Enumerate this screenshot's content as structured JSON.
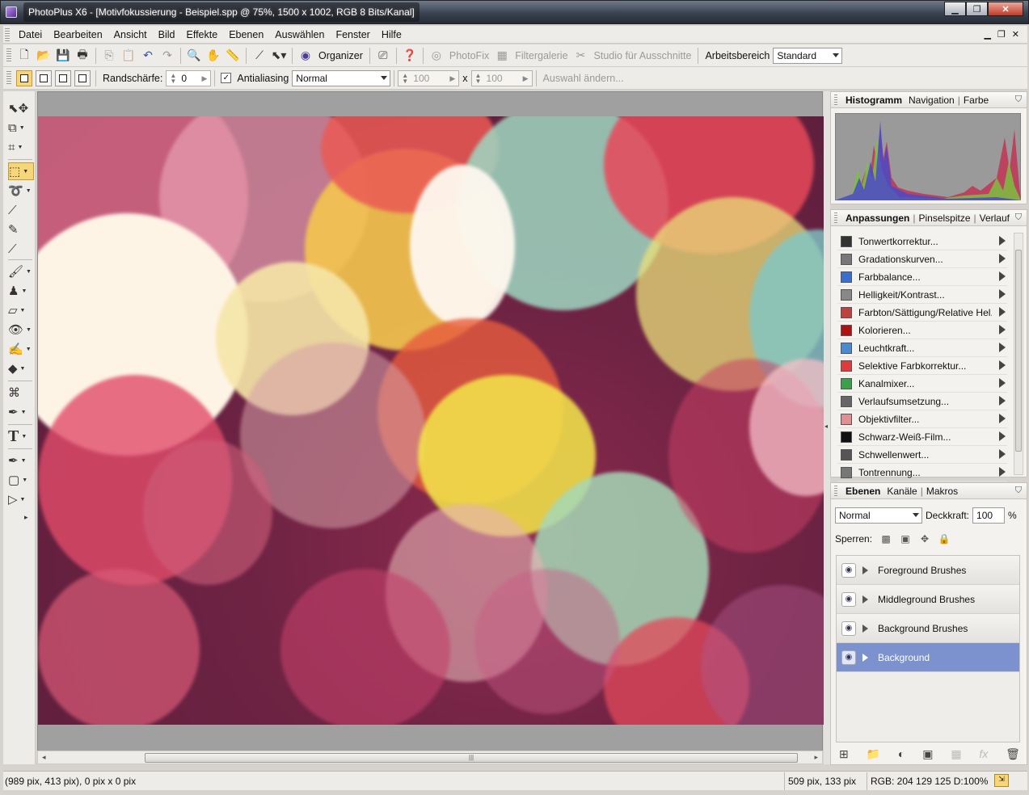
{
  "window": {
    "title": "PhotoPlus X6 - [Motivfokussierung - Beispiel.spp @ 75%, 1500 x 1002, RGB 8 Bits/Kanal]"
  },
  "menu": [
    "Datei",
    "Bearbeiten",
    "Ansicht",
    "Bild",
    "Effekte",
    "Ebenen",
    "Auswählen",
    "Fenster",
    "Hilfe"
  ],
  "toolbar": {
    "organizer": "Organizer",
    "photofix": "PhotoFix",
    "filtergalerie": "Filtergalerie",
    "studio": "Studio für Ausschnitte",
    "arbeitsbereich_label": "Arbeitsbereich",
    "arbeitsbereich_value": "Standard"
  },
  "options": {
    "randschaerfe_label": "Randschärfe:",
    "randschaerfe_value": "0",
    "antialiasing": "Antialiasing",
    "mode": "Normal",
    "width": "100",
    "times": "x",
    "height": "100",
    "auswahl": "Auswahl ändern..."
  },
  "panels": {
    "histogram": {
      "tabs": [
        "Histogramm",
        "Navigation",
        "Farbe"
      ]
    },
    "adjustments": {
      "tabs": [
        "Anpassungen",
        "Pinselspitze",
        "Verlauf"
      ],
      "items": [
        "Tonwertkorrektur...",
        "Gradationskurven...",
        "Farbbalance...",
        "Helligkeit/Kontrast...",
        "Farbton/Sättigung/Relative Hel...",
        "Kolorieren...",
        "Leuchtkraft...",
        "Selektive Farbkorrektur...",
        "Kanalmixer...",
        "Verlaufsumsetzung...",
        "Objektivfilter...",
        "Schwarz-Weiß-Film...",
        "Schwellenwert...",
        "Tontrennung..."
      ],
      "icon_colors": [
        "#333333",
        "#777777",
        "#3a6fd0",
        "#888888",
        "#c04040",
        "#b01010",
        "#4a8ad0",
        "#e03a3a",
        "#3aa04a",
        "#666666",
        "#e09090",
        "#111111",
        "#555555",
        "#777777"
      ]
    },
    "layers": {
      "tabs": [
        "Ebenen",
        "Kanäle",
        "Makros"
      ],
      "blend": "Normal",
      "opacity_label": "Deckkraft:",
      "opacity_value": "100",
      "opacity_unit": "%",
      "lock_label": "Sperren:",
      "items": [
        "Foreground Brushes",
        "Middleground Brushes",
        "Background Brushes",
        "Background"
      ]
    }
  },
  "status": {
    "coords": "(989 pix, 413 pix), 0 pix x 0 pix",
    "size": "509 pix, 133 pix",
    "rgb": "RGB: 204 129 125 D:100%"
  },
  "colors": {
    "accent": "#f7d67a",
    "selected_layer": "#7b92cf"
  }
}
